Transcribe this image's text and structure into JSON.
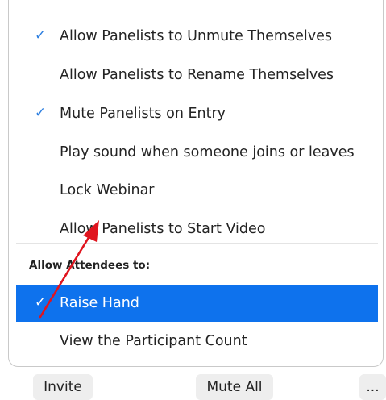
{
  "menu": {
    "items": [
      {
        "label": "Allow Panelists to Unmute Themselves",
        "checked": true,
        "check_mark": "✓"
      },
      {
        "label": "Allow Panelists to Rename Themselves",
        "checked": false,
        "check_mark": ""
      },
      {
        "label": "Mute Panelists on Entry",
        "checked": true,
        "check_mark": "✓"
      },
      {
        "label": "Play sound when someone joins or leaves",
        "checked": false,
        "check_mark": ""
      },
      {
        "label": "Lock Webinar",
        "checked": false,
        "check_mark": ""
      },
      {
        "label": "Allow Panelists to Start Video",
        "checked": false,
        "check_mark": ""
      }
    ],
    "attendees_section": {
      "header": "Allow Attendees to:",
      "items": [
        {
          "label": "Raise Hand",
          "checked": true,
          "selected": true,
          "check_mark": "✓"
        },
        {
          "label": "View the Participant Count",
          "checked": false,
          "selected": false,
          "check_mark": ""
        }
      ]
    }
  },
  "toolbar": {
    "invite_label": "Invite",
    "mute_all_label": "Mute All",
    "more_label": "..."
  },
  "colors": {
    "accent": "#0e72ed",
    "check": "#2d7fe0",
    "annotation_arrow": "#e0141e"
  },
  "icons": {
    "check": "checkmark-icon",
    "annotation": "red-arrow-annotation"
  }
}
